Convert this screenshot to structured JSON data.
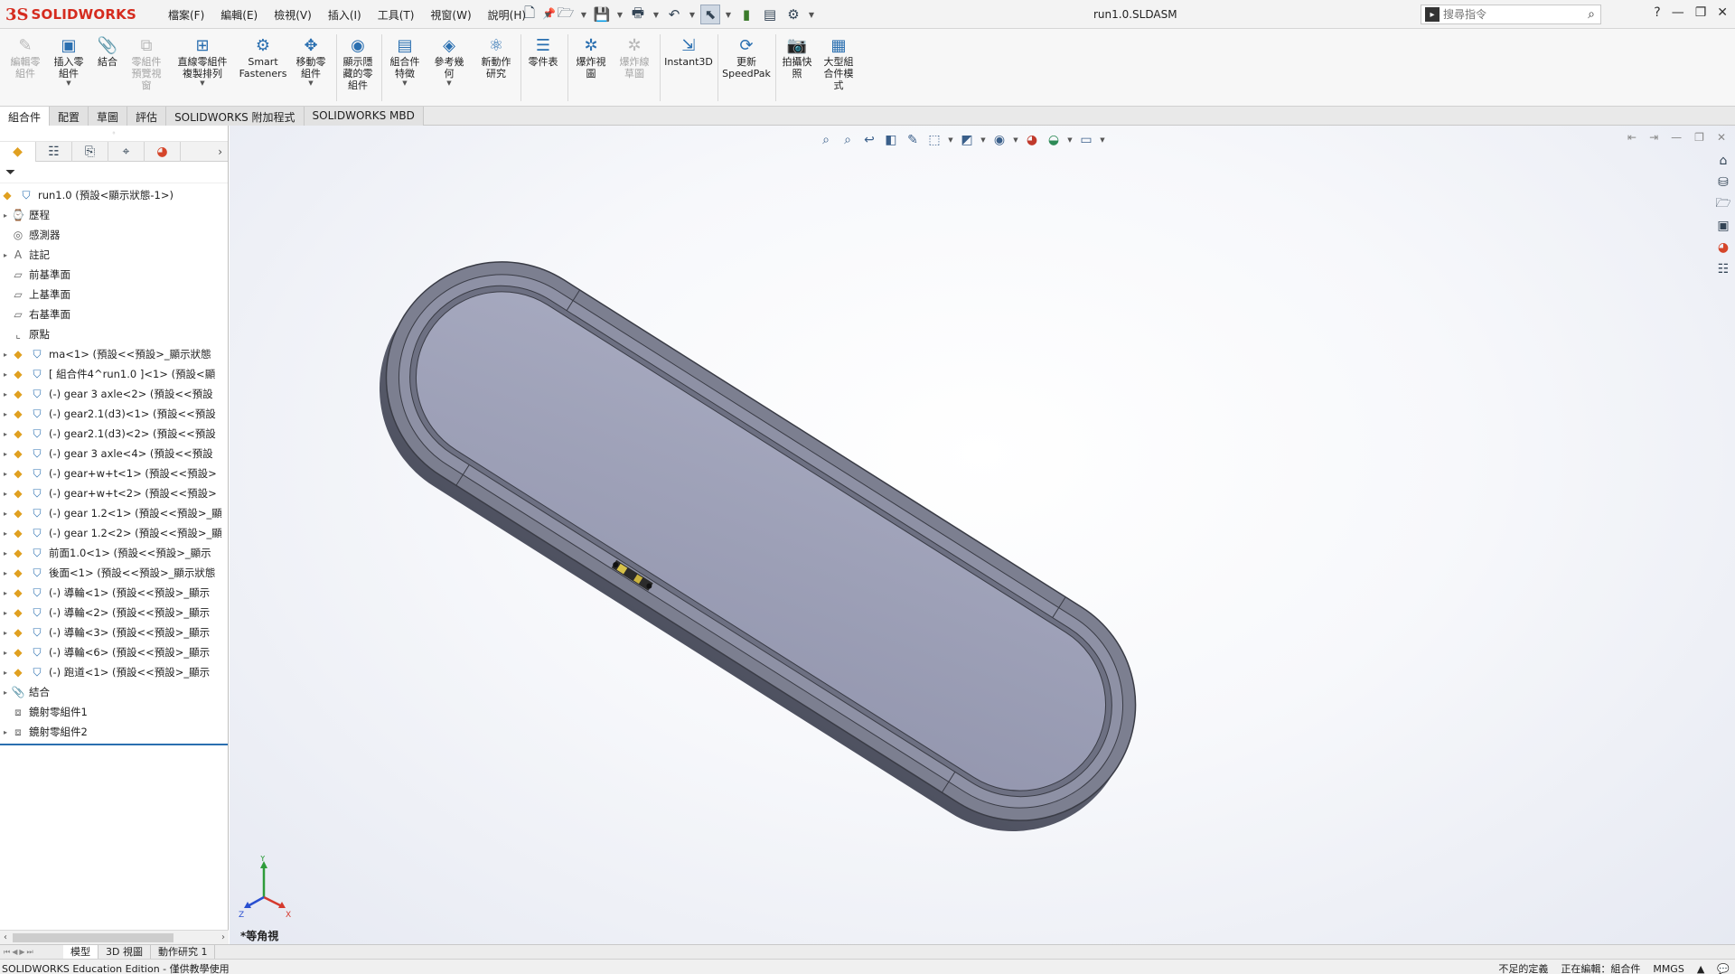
{
  "app": {
    "logo_ds": "3S",
    "logo_name": "SOLIDWORKS",
    "document_title": "run1.0.SLDASM"
  },
  "menus": [
    "檔案(F)",
    "編輯(E)",
    "檢視(V)",
    "插入(I)",
    "工具(T)",
    "視窗(W)",
    "說明(H)"
  ],
  "search": {
    "placeholder": "搜尋指令"
  },
  "ribbon": [
    {
      "id": "edit-component",
      "label": "編輯零\n組件",
      "disabled": true,
      "icon": "edit-component-icon",
      "glyph": "✎"
    },
    {
      "id": "insert-components",
      "label": "插入零\n組件",
      "disabled": false,
      "icon": "insert-components-icon",
      "glyph": "▣"
    },
    {
      "id": "mate",
      "label": "結合",
      "disabled": false,
      "icon": "mate-icon",
      "glyph": "📎"
    },
    {
      "id": "component-preview",
      "label": "零組件\n預覽視\n窗",
      "disabled": true,
      "icon": "component-preview-icon",
      "glyph": "⧉"
    },
    {
      "id": "linear-pattern",
      "label": "直線零組件\n複製排列",
      "disabled": false,
      "icon": "linear-pattern-icon",
      "glyph": "⊞"
    },
    {
      "id": "smart-fasteners",
      "label": "Smart\nFasteners",
      "disabled": false,
      "icon": "smart-fasteners-icon",
      "glyph": "⚙"
    },
    {
      "id": "move-component",
      "label": "移動零\n組件",
      "disabled": false,
      "icon": "move-component-icon",
      "glyph": "✥"
    },
    {
      "id": "show-hidden",
      "label": "顯示隱\n藏的零\n組件",
      "disabled": false,
      "icon": "show-hidden-icon",
      "glyph": "◉"
    },
    {
      "id": "assembly-features",
      "label": "組合件\n特徵",
      "disabled": false,
      "icon": "assembly-features-icon",
      "glyph": "▤"
    },
    {
      "id": "reference-geometry",
      "label": "參考幾\n何",
      "disabled": false,
      "icon": "reference-geometry-icon",
      "glyph": "◈"
    },
    {
      "id": "new-motion-study",
      "label": "新動作\n研究",
      "disabled": false,
      "icon": "motion-study-icon",
      "glyph": "⚛"
    },
    {
      "id": "bill-of-materials",
      "label": "零件表",
      "disabled": false,
      "icon": "bom-icon",
      "glyph": "☰"
    },
    {
      "id": "exploded-view",
      "label": "爆炸視\n圖",
      "disabled": false,
      "icon": "exploded-view-icon",
      "glyph": "✲"
    },
    {
      "id": "explode-line-sketch",
      "label": "爆炸線\n草圖",
      "disabled": true,
      "icon": "explode-line-icon",
      "glyph": "✲"
    },
    {
      "id": "instant3d",
      "label": "Instant3D",
      "disabled": false,
      "icon": "instant3d-icon",
      "glyph": "⇲"
    },
    {
      "id": "update-speedpak",
      "label": "更新\nSpeedPak",
      "disabled": false,
      "icon": "speedpak-icon",
      "glyph": "⟳"
    },
    {
      "id": "take-snapshot",
      "label": "拍攝快\n照",
      "disabled": false,
      "icon": "camera-icon",
      "glyph": "📷"
    },
    {
      "id": "large-assembly-mode",
      "label": "大型組\n合件模\n式",
      "disabled": false,
      "icon": "large-assembly-icon",
      "glyph": "▦"
    }
  ],
  "tabs": [
    "組合件",
    "配置",
    "草圖",
    "評估",
    "SOLIDWORKS 附加程式",
    "SOLIDWORKS MBD"
  ],
  "tree": {
    "root": "run1.0 (預設<顯示狀態-1>)",
    "items": [
      {
        "label": "歷程",
        "expand": true,
        "icon": "history-icon",
        "glyph": "⌚"
      },
      {
        "label": "感測器",
        "expand": false,
        "icon": "sensor-icon",
        "glyph": "◎"
      },
      {
        "label": "註記",
        "expand": true,
        "icon": "annotations-icon",
        "glyph": "A"
      },
      {
        "label": "前基準面",
        "expand": false,
        "icon": "plane-icon",
        "glyph": "▱"
      },
      {
        "label": "上基準面",
        "expand": false,
        "icon": "plane-icon",
        "glyph": "▱"
      },
      {
        "label": "右基準面",
        "expand": false,
        "icon": "plane-icon",
        "glyph": "▱"
      },
      {
        "label": "原點",
        "expand": false,
        "icon": "origin-icon",
        "glyph": "⌞"
      },
      {
        "label": "ma<1> (預設<<預設>_顯示狀態",
        "expand": true,
        "icon": "part-icon",
        "comp": true
      },
      {
        "label": "[ 組合件4^run1.0 ]<1> (預設<顯",
        "expand": true,
        "icon": "subassembly-icon",
        "comp": true
      },
      {
        "label": "(-) gear 3 axle<2> (預設<<預設",
        "expand": true,
        "icon": "part-icon",
        "comp": true
      },
      {
        "label": "(-) gear2.1(d3)<1> (預設<<預設",
        "expand": true,
        "icon": "part-icon",
        "comp": true
      },
      {
        "label": "(-) gear2.1(d3)<2> (預設<<預設",
        "expand": true,
        "icon": "part-icon",
        "comp": true
      },
      {
        "label": "(-) gear 3 axle<4> (預設<<預設",
        "expand": true,
        "icon": "part-icon",
        "comp": true
      },
      {
        "label": "(-) gear+w+t<1> (預設<<預設>",
        "expand": true,
        "icon": "part-icon",
        "comp": true
      },
      {
        "label": "(-) gear+w+t<2> (預設<<預設>",
        "expand": true,
        "icon": "part-icon",
        "comp": true
      },
      {
        "label": "(-) gear 1.2<1> (預設<<預設>_顯",
        "expand": true,
        "icon": "part-icon",
        "comp": true
      },
      {
        "label": "(-) gear 1.2<2> (預設<<預設>_顯",
        "expand": true,
        "icon": "part-icon",
        "comp": true
      },
      {
        "label": "前面1.0<1> (預設<<預設>_顯示",
        "expand": true,
        "icon": "part-icon",
        "comp": true
      },
      {
        "label": "後面<1> (預設<<預設>_顯示狀態",
        "expand": true,
        "icon": "part-icon",
        "comp": true
      },
      {
        "label": "(-) 導輪<1> (預設<<預設>_顯示",
        "expand": true,
        "icon": "part-icon",
        "comp": true
      },
      {
        "label": "(-) 導輪<2> (預設<<預設>_顯示",
        "expand": true,
        "icon": "part-icon",
        "comp": true
      },
      {
        "label": "(-) 導輪<3> (預設<<預設>_顯示",
        "expand": true,
        "icon": "part-icon",
        "comp": true
      },
      {
        "label": "(-) 導輪<6> (預設<<預設>_顯示",
        "expand": true,
        "icon": "part-icon",
        "comp": true
      },
      {
        "label": "(-) 跑道<1> (預設<<預設>_顯示",
        "expand": true,
        "icon": "part-icon",
        "comp": true
      },
      {
        "label": "結合",
        "expand": true,
        "icon": "mates-folder-icon",
        "glyph": "📎"
      },
      {
        "label": "鏡射零組件1",
        "expand": false,
        "icon": "mirror-component-icon",
        "glyph": "⧈"
      },
      {
        "label": "鏡射零組件2",
        "expand": true,
        "icon": "mirror-component-icon",
        "glyph": "⧈"
      }
    ]
  },
  "viewport": {
    "view_label": "*等角視",
    "triad": {
      "x": "X",
      "y": "Y",
      "z": "Z"
    }
  },
  "bottom_tabs": [
    "模型",
    "3D 視圖",
    "動作研究 1"
  ],
  "status": {
    "left": "SOLIDWORKS Education Edition - 僅供教學使用",
    "definition": "不足的定義",
    "editing": "正在編輯：組合件",
    "units": "MMGS"
  },
  "colors": {
    "accent": "#2a6fb0",
    "logo_red": "#d52b1e",
    "track_side": "#5a5d6b",
    "track_top": "#9fa2b8",
    "track_rim": "#7b7e90"
  }
}
